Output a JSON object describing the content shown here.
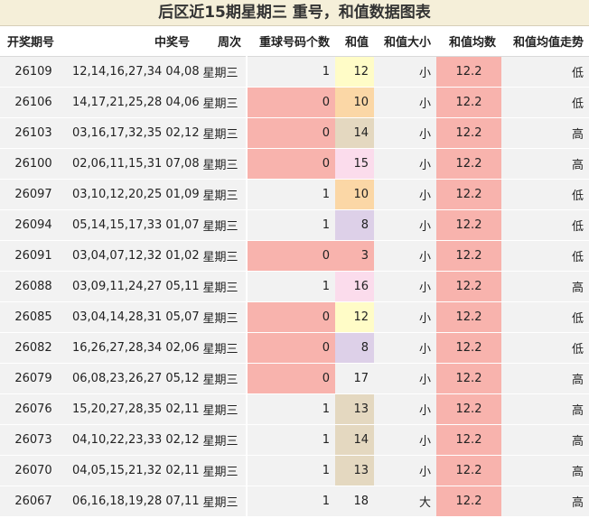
{
  "title": "后区近15期星期三  重号，和值数据图表",
  "headers": [
    "开奖期号",
    "中奖号",
    "周次",
    "重球号码个数",
    "和值",
    "和值大小",
    "和值均数",
    "和值均值走势"
  ],
  "rows": [
    {
      "issue": "26109",
      "numbers": "12,14,16,27,34 04,08",
      "weekday": "星期三",
      "repeat": "1",
      "sum": "12",
      "size": "小",
      "avg": "12.2",
      "trend": "低"
    },
    {
      "issue": "26106",
      "numbers": "14,17,21,25,28 04,06",
      "weekday": "星期三",
      "repeat": "0",
      "sum": "10",
      "size": "小",
      "avg": "12.2",
      "trend": "低"
    },
    {
      "issue": "26103",
      "numbers": "03,16,17,32,35 02,12",
      "weekday": "星期三",
      "repeat": "0",
      "sum": "14",
      "size": "小",
      "avg": "12.2",
      "trend": "高"
    },
    {
      "issue": "26100",
      "numbers": "02,06,11,15,31 07,08",
      "weekday": "星期三",
      "repeat": "0",
      "sum": "15",
      "size": "小",
      "avg": "12.2",
      "trend": "高"
    },
    {
      "issue": "26097",
      "numbers": "03,10,12,20,25 01,09",
      "weekday": "星期三",
      "repeat": "1",
      "sum": "10",
      "size": "小",
      "avg": "12.2",
      "trend": "低"
    },
    {
      "issue": "26094",
      "numbers": "05,14,15,17,33 01,07",
      "weekday": "星期三",
      "repeat": "1",
      "sum": "8",
      "size": "小",
      "avg": "12.2",
      "trend": "低"
    },
    {
      "issue": "26091",
      "numbers": "03,04,07,12,32 01,02",
      "weekday": "星期三",
      "repeat": "0",
      "sum": "3",
      "size": "小",
      "avg": "12.2",
      "trend": "低"
    },
    {
      "issue": "26088",
      "numbers": "03,09,11,24,27 05,11",
      "weekday": "星期三",
      "repeat": "1",
      "sum": "16",
      "size": "小",
      "avg": "12.2",
      "trend": "高"
    },
    {
      "issue": "26085",
      "numbers": "03,04,14,28,31 05,07",
      "weekday": "星期三",
      "repeat": "0",
      "sum": "12",
      "size": "小",
      "avg": "12.2",
      "trend": "低"
    },
    {
      "issue": "26082",
      "numbers": "16,26,27,28,34 02,06",
      "weekday": "星期三",
      "repeat": "0",
      "sum": "8",
      "size": "小",
      "avg": "12.2",
      "trend": "低"
    },
    {
      "issue": "26079",
      "numbers": "06,08,23,26,27 05,12",
      "weekday": "星期三",
      "repeat": "0",
      "sum": "17",
      "size": "小",
      "avg": "12.2",
      "trend": "高"
    },
    {
      "issue": "26076",
      "numbers": "15,20,27,28,35 02,11",
      "weekday": "星期三",
      "repeat": "1",
      "sum": "13",
      "size": "小",
      "avg": "12.2",
      "trend": "高"
    },
    {
      "issue": "26073",
      "numbers": "04,10,22,23,33 02,12",
      "weekday": "星期三",
      "repeat": "1",
      "sum": "14",
      "size": "小",
      "avg": "12.2",
      "trend": "高"
    },
    {
      "issue": "26070",
      "numbers": "04,05,15,21,32 02,11",
      "weekday": "星期三",
      "repeat": "1",
      "sum": "13",
      "size": "小",
      "avg": "12.2",
      "trend": "高"
    },
    {
      "issue": "26067",
      "numbers": "06,16,18,19,28 07,11",
      "weekday": "星期三",
      "repeat": "1",
      "sum": "18",
      "size": "大",
      "avg": "12.2",
      "trend": "高"
    }
  ]
}
